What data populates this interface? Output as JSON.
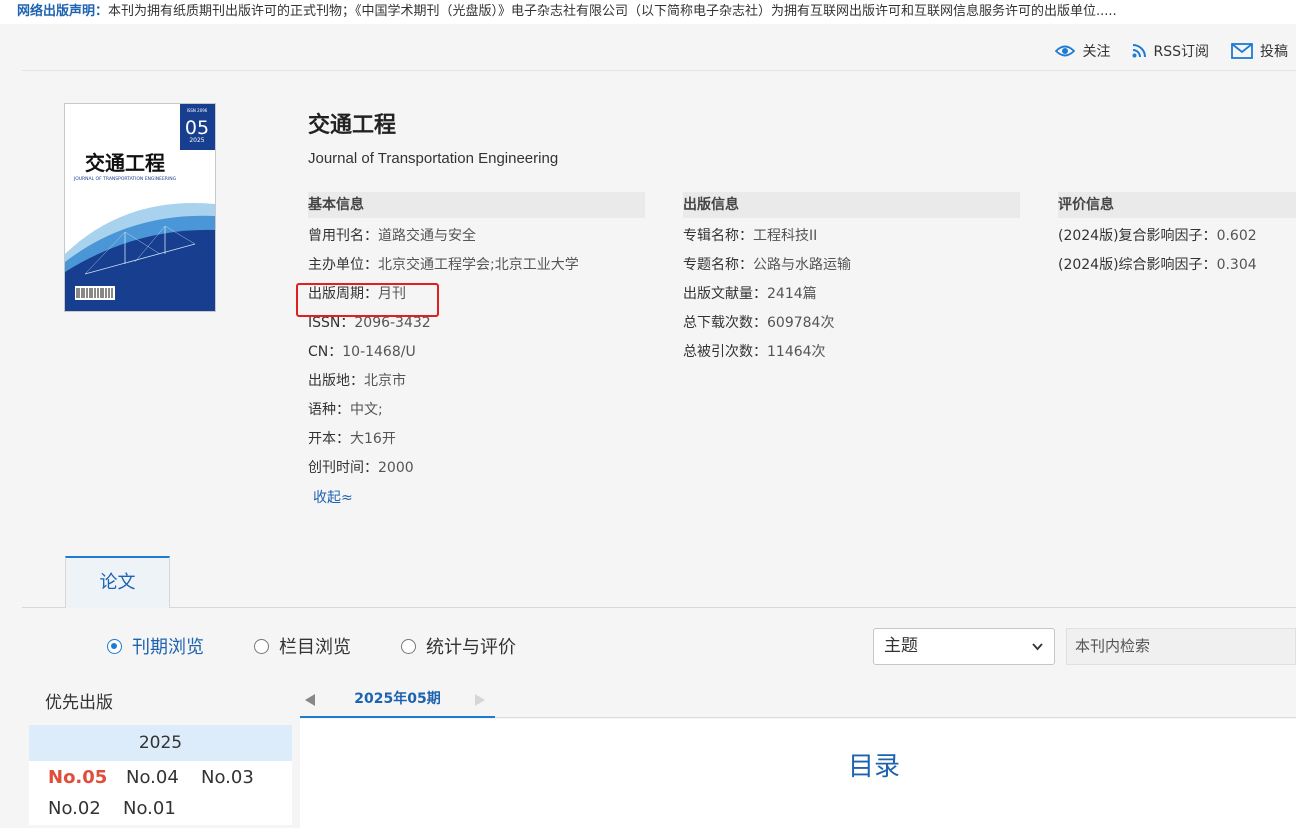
{
  "notice": {
    "label": "网络出版声明：",
    "text": "本刊为拥有纸质期刊出版许可的正式刊物；《中国学术期刊（光盘版）》电子杂志社有限公司（以下简称电子杂志社）为拥有互联网出版许可和互联网信息服务许可的出版单位....."
  },
  "actions": {
    "follow": "关注",
    "rss": "RSS订阅",
    "submit": "投稿"
  },
  "cover": {
    "issue": "05",
    "year": "2025",
    "title": "交通工程",
    "subtitle": "JOURNAL OF TRANSPORTATION ENGINEERING"
  },
  "journal": {
    "title": "交通工程",
    "english": "Journal of Transportation Engineering"
  },
  "basic": {
    "heading": "基本信息",
    "rows": [
      {
        "k": "曾用刊名：",
        "v": "道路交通与安全"
      },
      {
        "k": "主办单位：",
        "v": "北京交通工程学会;北京工业大学"
      },
      {
        "k": "出版周期：",
        "v": "月刊"
      },
      {
        "k": "ISSN：",
        "v": "2096-3432"
      },
      {
        "k": "CN：",
        "v": "10-1468/U"
      },
      {
        "k": "出版地：",
        "v": "北京市"
      },
      {
        "k": "语种：",
        "v": "中文;"
      },
      {
        "k": "开本：",
        "v": "大16开"
      },
      {
        "k": "创刊时间：",
        "v": "2000"
      }
    ],
    "collapse": "收起≈"
  },
  "publish": {
    "heading": "出版信息",
    "rows": [
      {
        "k": "专辑名称：",
        "v": "工程科技II"
      },
      {
        "k": "专题名称：",
        "v": "公路与水路运输"
      },
      {
        "k": "出版文献量：",
        "v": "2414篇"
      },
      {
        "k": "总下载次数：",
        "v": "609784次"
      },
      {
        "k": "总被引次数：",
        "v": "11464次"
      }
    ]
  },
  "evaluation": {
    "heading": "评价信息",
    "rows": [
      {
        "k": "(2024版)复合影响因子：",
        "v": "0.602"
      },
      {
        "k": "(2024版)综合影响因子：",
        "v": "0.304"
      }
    ]
  },
  "tabs": {
    "papers": "论文"
  },
  "browse": {
    "options": [
      "刊期浏览",
      "栏目浏览",
      "统计与评价"
    ],
    "selected": "刊期浏览"
  },
  "search": {
    "field_value": "主题",
    "placeholder": "本刊内检索"
  },
  "priority": {
    "label": "优先出版"
  },
  "issues": {
    "year": "2025",
    "list": [
      "No.05",
      "No.04",
      "No.03",
      "No.02",
      "No.01"
    ],
    "current": "No.05"
  },
  "period": {
    "label": "2025年05期"
  },
  "contents": {
    "title": "目录"
  },
  "colors": {
    "accent": "#1e63b0",
    "highlight": "#e02020",
    "current_issue": "#e04d3c"
  }
}
